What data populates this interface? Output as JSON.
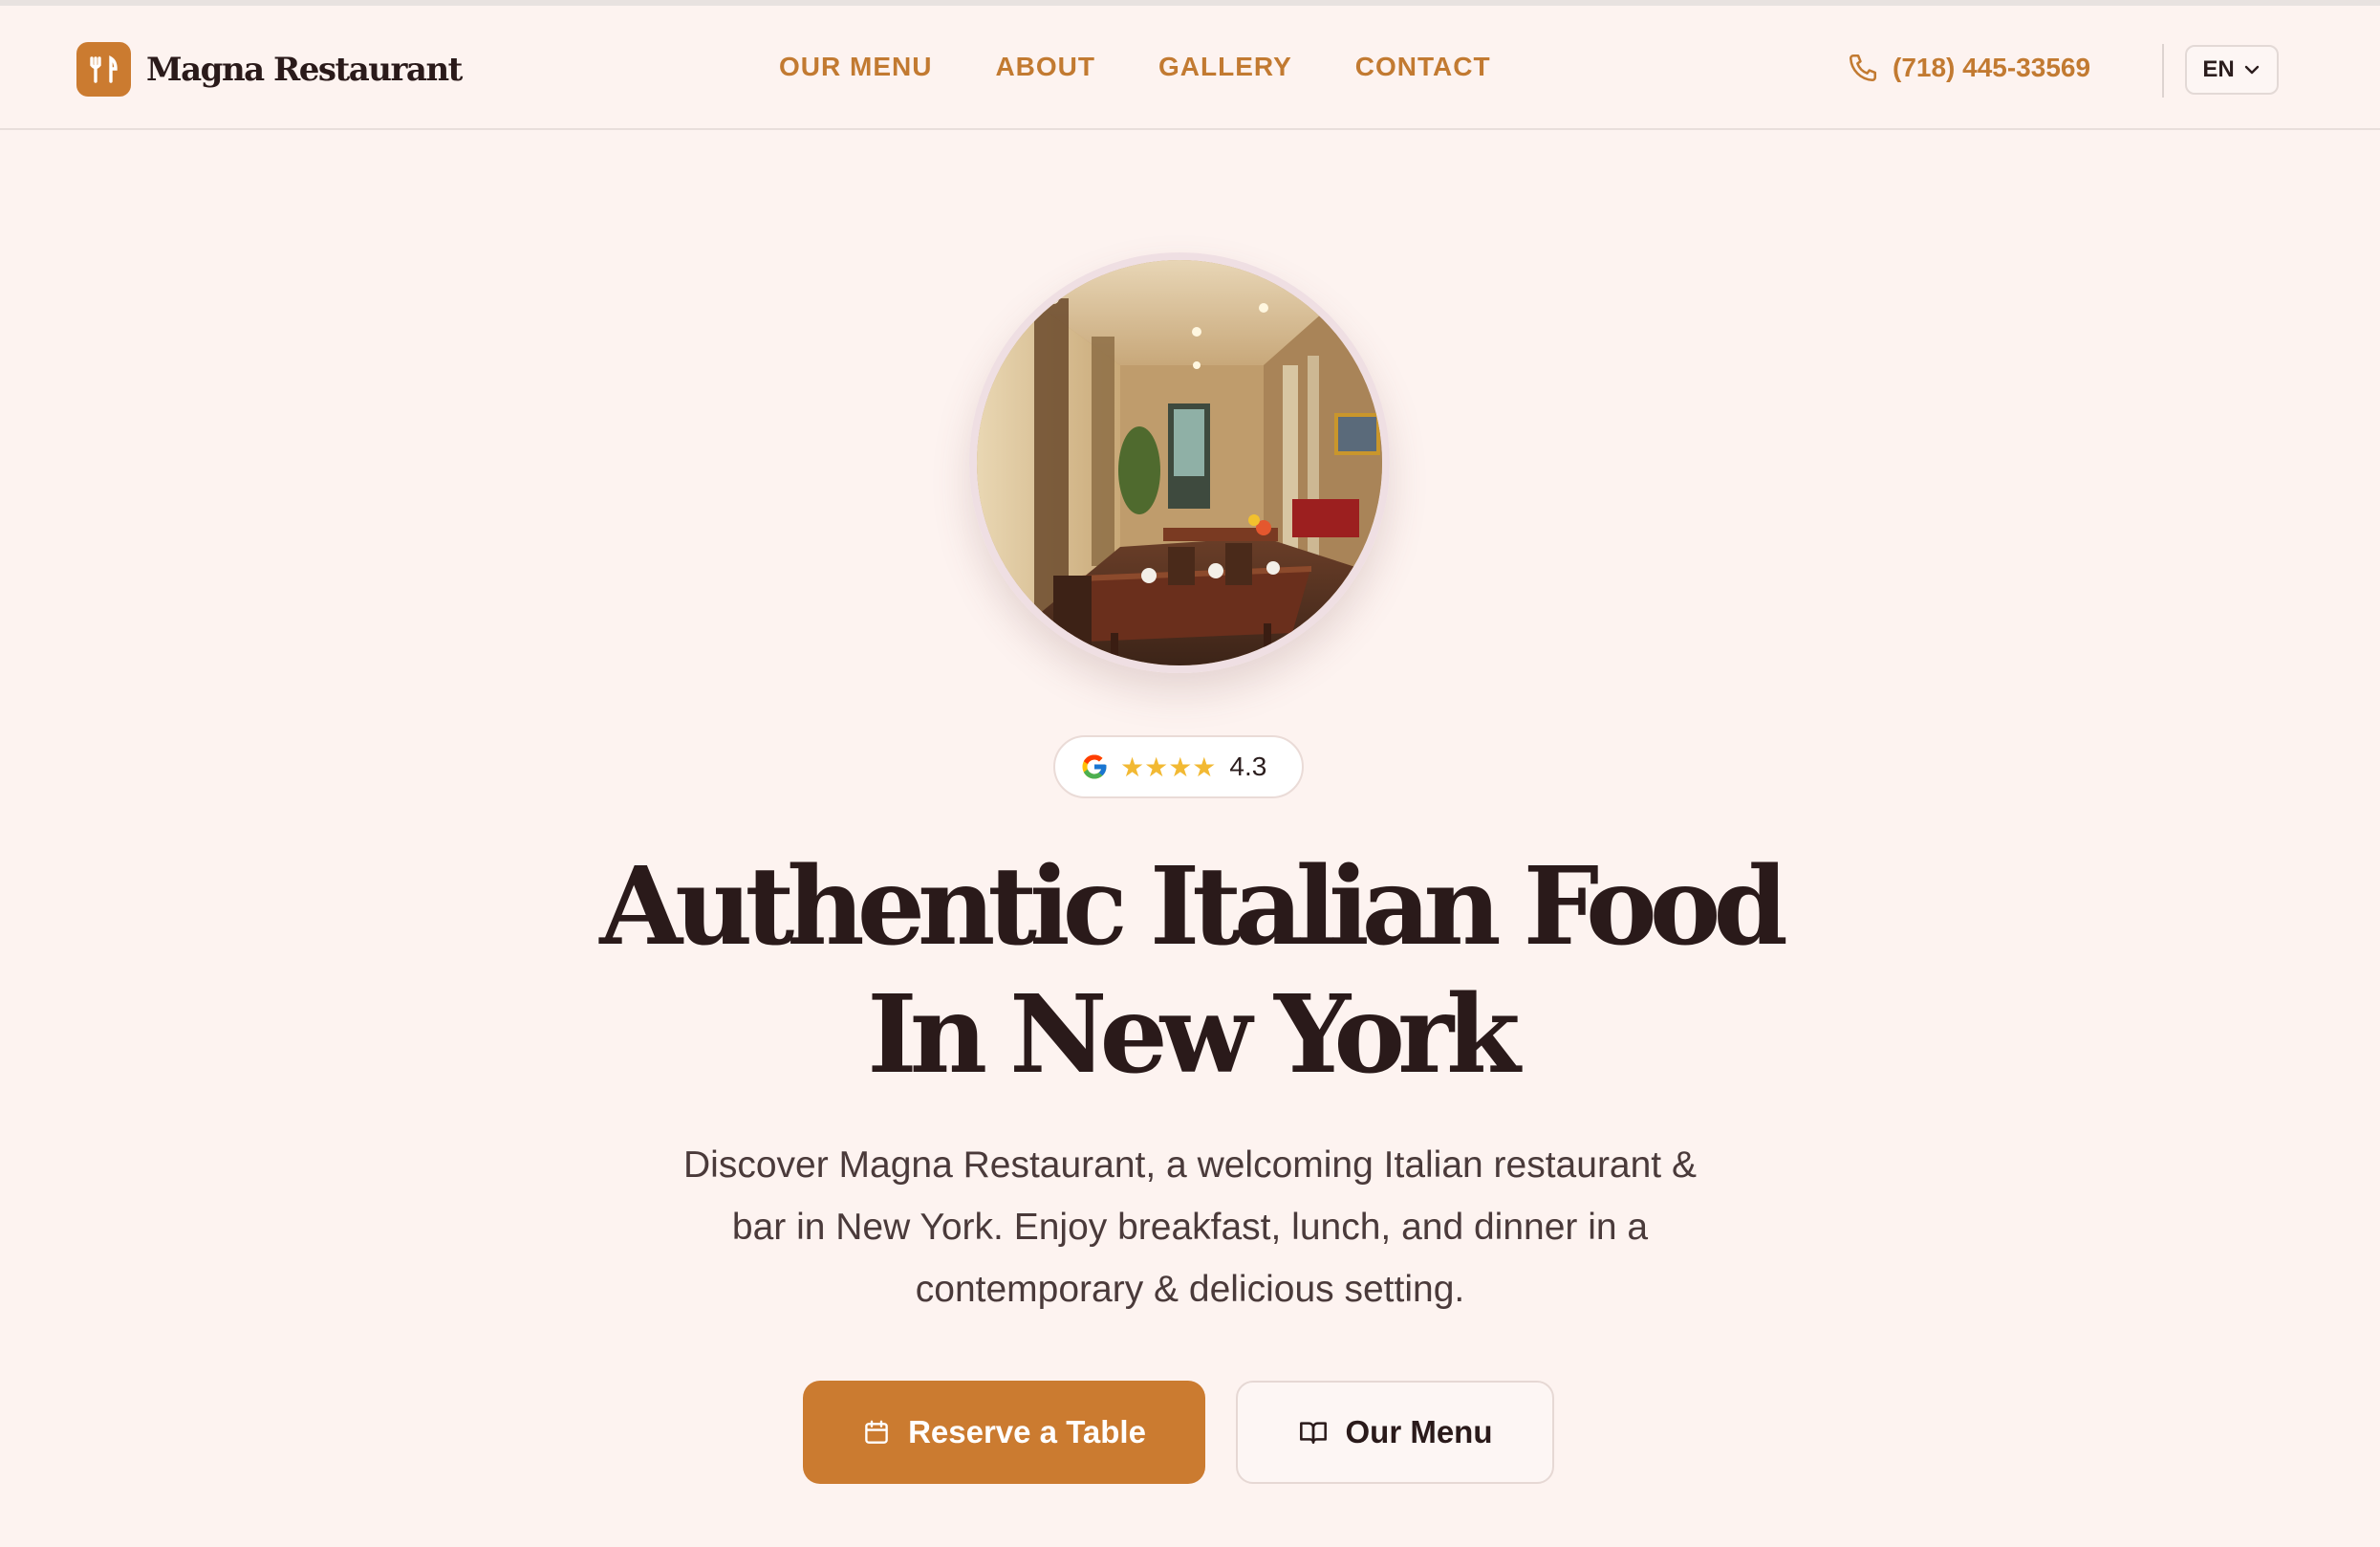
{
  "brand": {
    "name": "Magna Restaurant",
    "accent_color": "#cb7b30"
  },
  "nav": {
    "items": [
      {
        "label": "OUR MENU"
      },
      {
        "label": "ABOUT"
      },
      {
        "label": "GALLERY"
      },
      {
        "label": "CONTACT"
      }
    ]
  },
  "contact": {
    "phone": "(718) 445-33569",
    "phone_icon": "phone-icon"
  },
  "language": {
    "selected": "EN"
  },
  "rating": {
    "source_icon": "google-icon",
    "stars": "★★★★",
    "value": "4.3"
  },
  "hero": {
    "title_line1": "Authentic Italian Food",
    "title_line2": "In New York",
    "subtitle_line1": "Discover Magna Restaurant, a welcoming Italian restaurant &",
    "subtitle_line2": "bar in New York. Enjoy breakfast, lunch, and dinner in a",
    "subtitle_line3": "contemporary & delicious setting."
  },
  "actions": {
    "reserve_label": "Reserve a Table",
    "reserve_icon": "calendar-icon",
    "menu_label": "Our Menu",
    "menu_icon": "book-open-icon"
  }
}
